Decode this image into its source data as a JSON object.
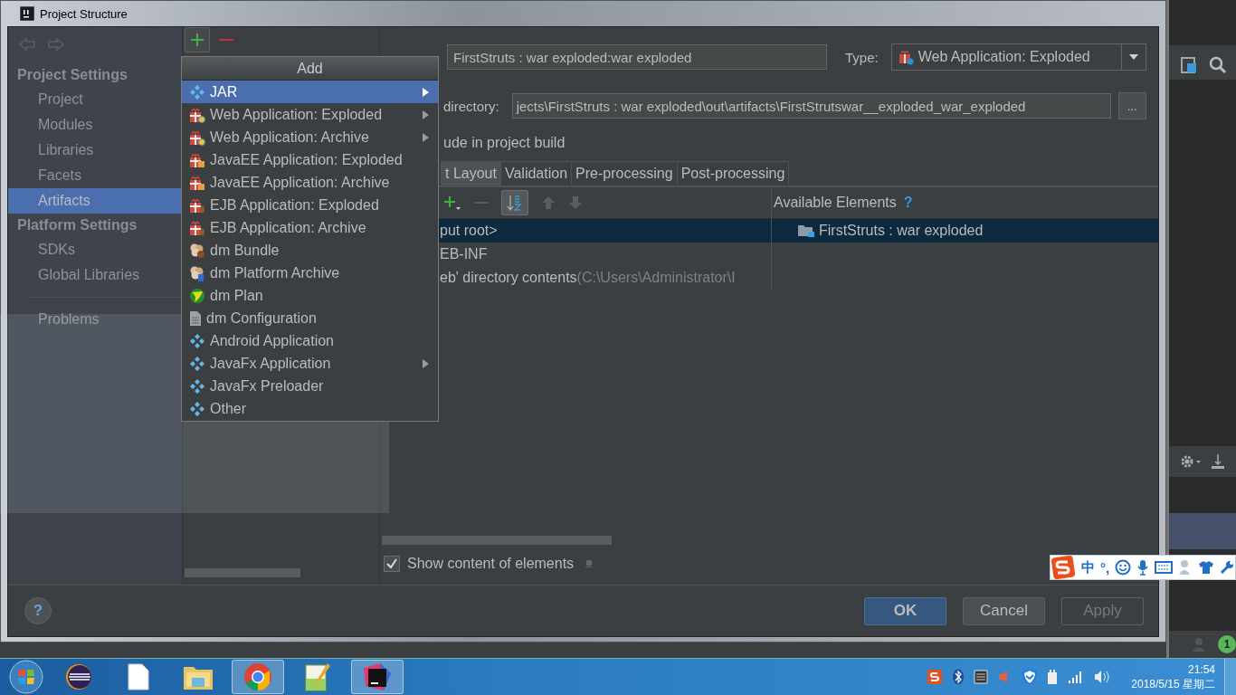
{
  "window": {
    "title": "Project Structure"
  },
  "sidebar": {
    "sections": [
      {
        "title": "Project Settings",
        "items": [
          {
            "label": "Project",
            "selected": false
          },
          {
            "label": "Modules",
            "selected": false
          },
          {
            "label": "Libraries",
            "selected": false
          },
          {
            "label": "Facets",
            "selected": false
          },
          {
            "label": "Artifacts",
            "selected": true
          }
        ]
      },
      {
        "title": "Platform Settings",
        "items": [
          {
            "label": "SDKs",
            "selected": false
          },
          {
            "label": "Global Libraries",
            "selected": false
          }
        ]
      }
    ],
    "extra_items": [
      {
        "label": "Problems",
        "selected": false
      }
    ]
  },
  "add_menu": {
    "title": "Add",
    "items": [
      {
        "label": "JAR",
        "kind": "diamond",
        "submenu": true,
        "selected": true
      },
      {
        "label": "Web Application: Exploded",
        "kind": "web",
        "submenu": true,
        "selected": false
      },
      {
        "label": "Web Application: Archive",
        "kind": "web",
        "submenu": true,
        "selected": false
      },
      {
        "label": "JavaEE Application: Exploded",
        "kind": "javaee",
        "submenu": false,
        "selected": false
      },
      {
        "label": "JavaEE Application: Archive",
        "kind": "javaee",
        "submenu": false,
        "selected": false
      },
      {
        "label": "EJB Application: Exploded",
        "kind": "ejb",
        "submenu": false,
        "selected": false
      },
      {
        "label": "EJB Application: Archive",
        "kind": "ejb",
        "submenu": false,
        "selected": false
      },
      {
        "label": "dm Bundle",
        "kind": "bundle",
        "submenu": false,
        "selected": false
      },
      {
        "label": "dm Platform Archive",
        "kind": "platform",
        "submenu": false,
        "selected": false
      },
      {
        "label": "dm Plan",
        "kind": "plan",
        "submenu": false,
        "selected": false
      },
      {
        "label": "dm Configuration",
        "kind": "config",
        "submenu": false,
        "selected": false
      },
      {
        "label": "Android Application",
        "kind": "diamond",
        "submenu": false,
        "selected": false
      },
      {
        "label": "JavaFx Application",
        "kind": "diamond",
        "submenu": true,
        "selected": false
      },
      {
        "label": "JavaFx Preloader",
        "kind": "diamond",
        "submenu": false,
        "selected": false
      },
      {
        "label": "Other",
        "kind": "diamond",
        "submenu": false,
        "selected": false
      }
    ]
  },
  "artifact": {
    "name_value": "FirstStruts : war  exploded:war exploded",
    "type_label": "Type:",
    "type_value": "Web Application: Exploded",
    "dir_label": "directory:",
    "dir_value": "jects\\FirstStruts : war  exploded\\out\\artifacts\\FirstStrutswar__exploded_war_exploded",
    "browse": "...",
    "include_label": "ude in project build",
    "tabs": [
      {
        "label": "t Layout",
        "selected": true
      },
      {
        "label": "Validation",
        "selected": false
      },
      {
        "label": "Pre-processing",
        "selected": false
      },
      {
        "label": "Post-processing",
        "selected": false
      }
    ],
    "available_label": "Available Elements",
    "available_help": "?",
    "layout_tree": [
      {
        "label": "put root>",
        "selected": true
      },
      {
        "label": "EB-INF",
        "selected": false
      },
      {
        "label": "eb' directory contents",
        "detail": "(C:\\Users\\Administrator\\I",
        "selected": false
      }
    ],
    "available_tree": [
      {
        "label": "FirstStruts : war  exploded",
        "selected": true
      }
    ],
    "show_content": {
      "label": "Show content of elements",
      "checked": true
    }
  },
  "help_button": "?",
  "buttons": [
    {
      "label": "OK",
      "kind": "default"
    },
    {
      "label": "Cancel",
      "kind": "normal"
    },
    {
      "label": "Apply",
      "kind": "disabled"
    }
  ],
  "ide": {
    "badge": "1"
  },
  "ime": {
    "mode": "中",
    "punct": "°,"
  },
  "taskbar": {
    "apps": [
      {
        "kind": "eclipse",
        "active": false
      },
      {
        "kind": "file",
        "active": false
      },
      {
        "kind": "folder",
        "active": false
      },
      {
        "kind": "chrome",
        "active": true
      },
      {
        "kind": "notepad",
        "active": false
      },
      {
        "kind": "intellij",
        "active": true
      }
    ],
    "time": "21:54",
    "date": "2018/5/15 星期二"
  }
}
